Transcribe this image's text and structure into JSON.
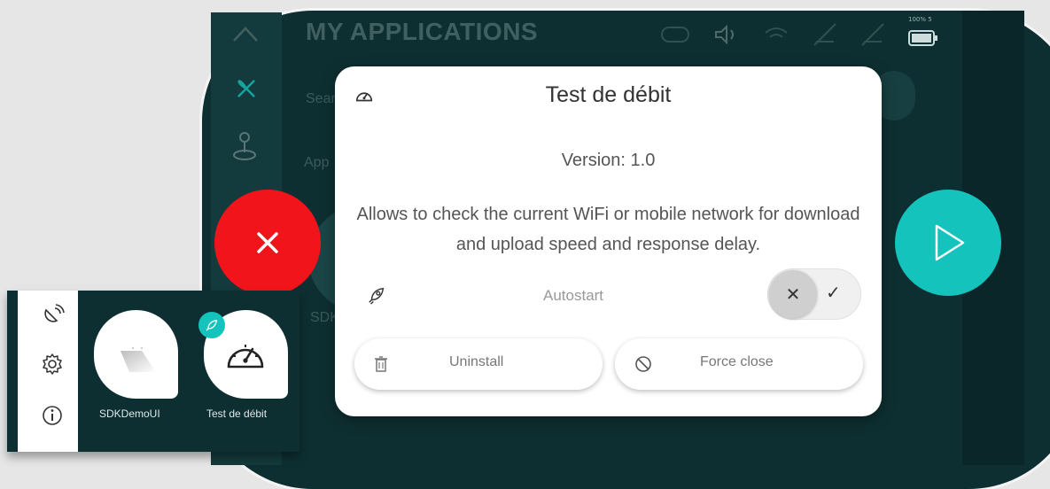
{
  "header": {
    "title": "MY APPLICATIONS"
  },
  "background": {
    "search_stub": "Sear",
    "apps_stub": "App",
    "sdk_stub": "SDK"
  },
  "status_icons": [
    "gamepad-icon",
    "volume-icon",
    "wifi-icon",
    "signal-off-icon",
    "signal-off-icon",
    "battery-icon"
  ],
  "battery_label": "100% 5",
  "modal": {
    "title": "Test de débit",
    "version": "Version: 1.0",
    "description": "Allows to check the current WiFi or mobile network for download and upload speed and response delay.",
    "autostart_label": "Autostart",
    "autostart_enabled": false,
    "uninstall_label": "Uninstall",
    "force_close_label": "Force close"
  },
  "inset": {
    "apps": [
      {
        "label": "SDKDemoUI"
      },
      {
        "label": "Test de débit"
      }
    ]
  },
  "colors": {
    "close": "#f2141b",
    "play": "#13c3bc",
    "background": "#0e2f31"
  }
}
